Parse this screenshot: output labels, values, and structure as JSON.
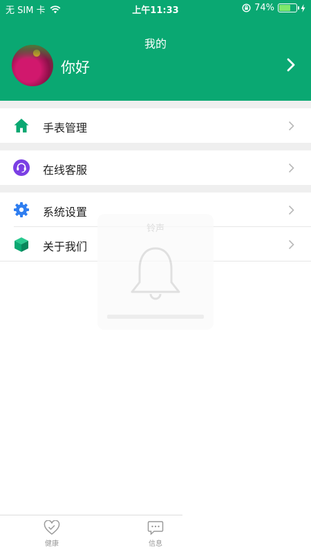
{
  "status_bar": {
    "carrier": "无 SIM 卡",
    "time": "上午11:33",
    "battery_percent": "74%",
    "battery_level": 0.74
  },
  "header": {
    "title": "我的",
    "username": "你好"
  },
  "menu": {
    "watch_management": "手表管理",
    "online_service": "在线客服",
    "system_settings": "系统设置",
    "about_us": "关于我们"
  },
  "overlay": {
    "title": "铃声"
  },
  "tabs": {
    "health": "健康",
    "messages": "信息"
  },
  "colors": {
    "brand": "#0aa872",
    "service_icon": "#7b3fe4",
    "settings_icon": "#2f7ef0"
  },
  "icons": {
    "home": "home-icon",
    "service": "headset-icon",
    "settings": "gear-icon",
    "about": "cube-icon",
    "chevron": "chevron-right-icon",
    "bell": "bell-icon",
    "heart": "heart-icon",
    "chat": "chat-icon"
  }
}
